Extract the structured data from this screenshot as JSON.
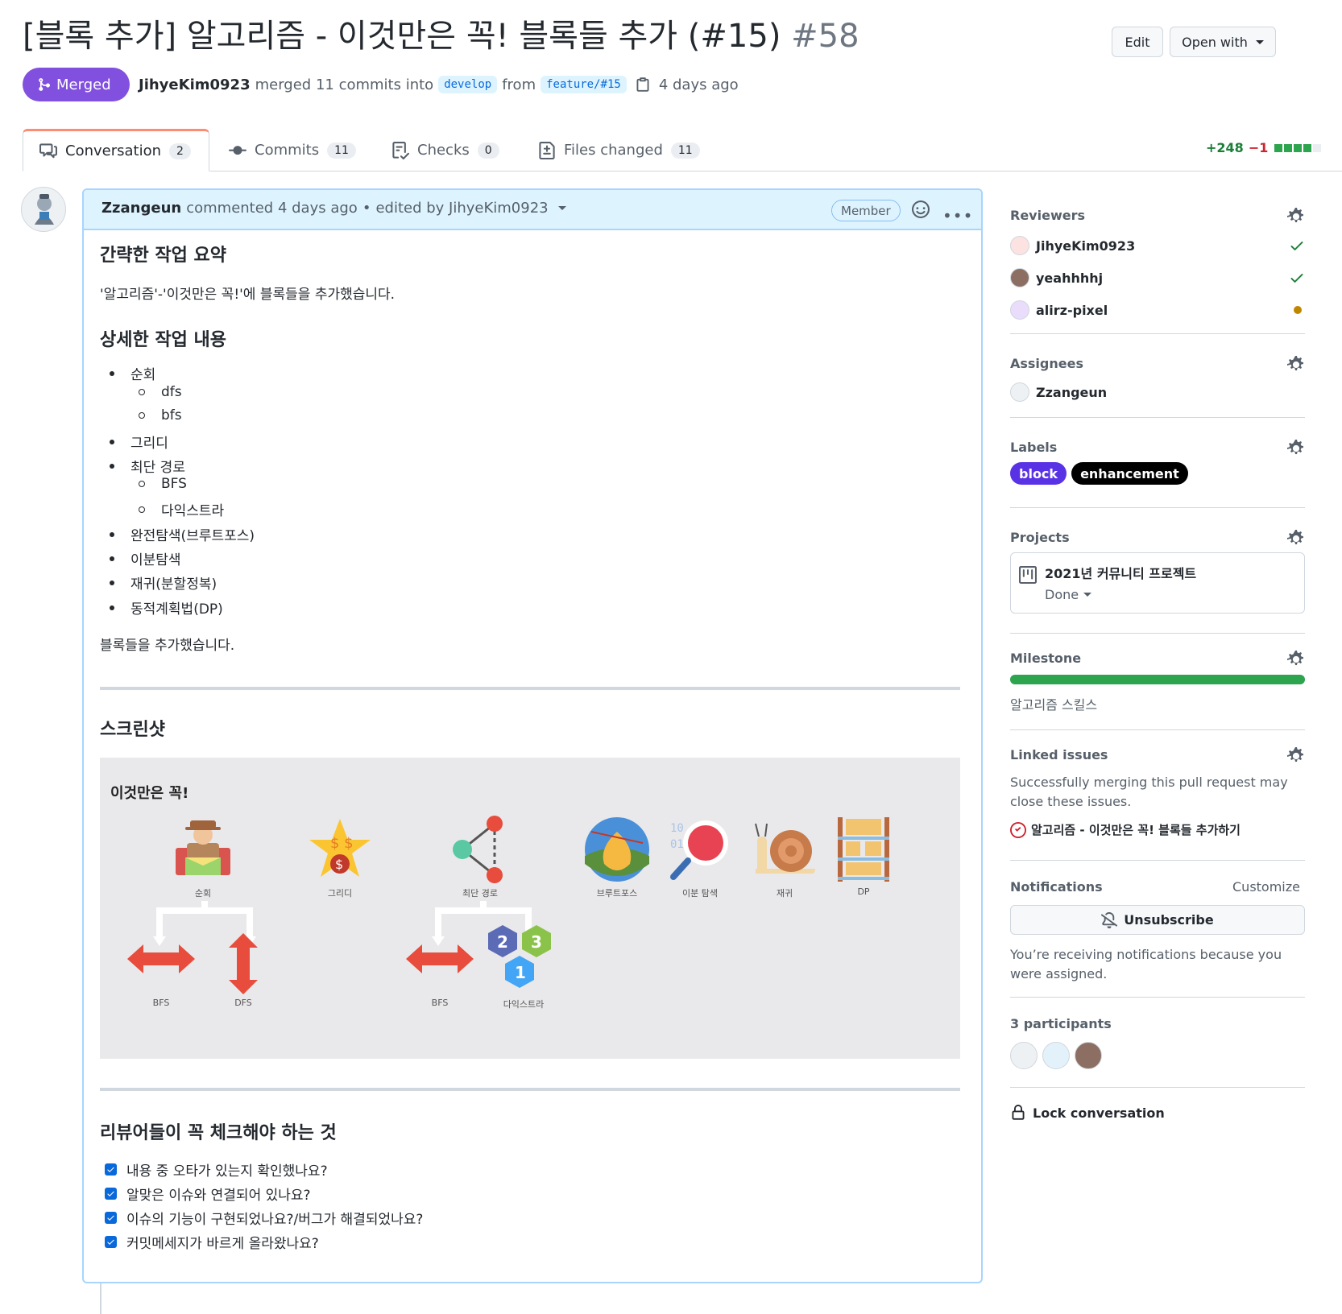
{
  "pr": {
    "title": "[블록 추가] 알고리즘 - 이것만은 꼭! 블록들 추가 (#15)",
    "number": "#58",
    "status": "Merged",
    "author": "JihyeKim0923",
    "merge_text": "merged 11 commits into",
    "base_branch": "develop",
    "from_text": "from",
    "head_branch": "feature/#15",
    "time": "4 days ago"
  },
  "header_actions": {
    "edit": "Edit",
    "open_with": "Open with"
  },
  "tabs": [
    {
      "label": "Conversation",
      "count": "2"
    },
    {
      "label": "Commits",
      "count": "11"
    },
    {
      "label": "Checks",
      "count": "0"
    },
    {
      "label": "Files changed",
      "count": "11"
    }
  ],
  "diffstat": {
    "additions": "+248",
    "deletions": "−1"
  },
  "comment": {
    "author": "Zzangeun",
    "commented": "commented 4 days ago",
    "edited": "edited by JihyeKim0923",
    "role": "Member",
    "summary_heading": "간략한 작업 요약",
    "summary_text": "'알고리즘'-'이것만은 꼭!'에 블록들을 추가했습니다.",
    "detail_heading": "상세한 작업 내용",
    "list": {
      "l1": "순회",
      "l1a": "dfs",
      "l1b": "bfs",
      "l2": "그리디",
      "l3": "최단 경로",
      "l3a": "BFS",
      "l3b": "다익스트라",
      "l4": "완전탐색(브루트포스)",
      "l5": "이분탐색",
      "l6": "재귀(분할정복)",
      "l7": "동적계획법(DP)"
    },
    "closing_text": "블록들을 추가했습니다.",
    "screenshot_heading": "스크린샷",
    "screenshot": {
      "title": "이것만은 꼭!",
      "labels": {
        "traverse": "순회",
        "greedy": "그리디",
        "shortest": "최단 경로",
        "brute": "브루트포스",
        "binary": "이분 탐색",
        "recur": "재귀",
        "dp": "DP",
        "bfs1": "BFS",
        "dfs": "DFS",
        "bfs2": "BFS",
        "dijkstra": "다익스트라"
      }
    },
    "review_heading": "리뷰어들이 꼭 체크해야 하는 것",
    "checklist": [
      "내용 중 오타가 있는지 확인했나요?",
      "알맞은 이슈와 연결되어 있나요?",
      "이슈의 기능이 구현되었나요?/버그가 해결되었나요?",
      "커밋메세지가 바르게 올라왔나요?"
    ]
  },
  "sidebar": {
    "reviewers_title": "Reviewers",
    "reviewers": [
      {
        "name": "JihyeKim0923",
        "state": "approved"
      },
      {
        "name": "yeahhhhj",
        "state": "approved"
      },
      {
        "name": "alirz-pixel",
        "state": "pending"
      }
    ],
    "assignees_title": "Assignees",
    "assignee": "Zzangeun",
    "labels_title": "Labels",
    "labels": [
      {
        "name": "block",
        "color": "#5a32e6"
      },
      {
        "name": "enhancement",
        "color": "#000000"
      }
    ],
    "projects_title": "Projects",
    "project_name": "2021년 커뮤니티 프로젝트",
    "project_status": "Done",
    "milestone_title": "Milestone",
    "milestone_progress": 1.0,
    "milestone_name": "알고리즘 스킬스",
    "linked_title": "Linked issues",
    "linked_desc_1": "Successfully merging this pull request may",
    "linked_desc_2": "close these issues.",
    "linked_issue": "알고리즘 - 이것만은 꼭! 블록들 추가하기",
    "notifications_title": "Notifications",
    "customize": "Customize",
    "unsubscribe": "Unsubscribe",
    "notif_reason_1": "You’re receiving notifications because you",
    "notif_reason_2": "were assigned.",
    "participants_title": "3 participants",
    "lock": "Lock conversation"
  },
  "colors": {
    "merged": "#8250df",
    "link": "#0969da",
    "success": "#1a7f37",
    "danger": "#cf222e",
    "pending": "#bf8700"
  }
}
